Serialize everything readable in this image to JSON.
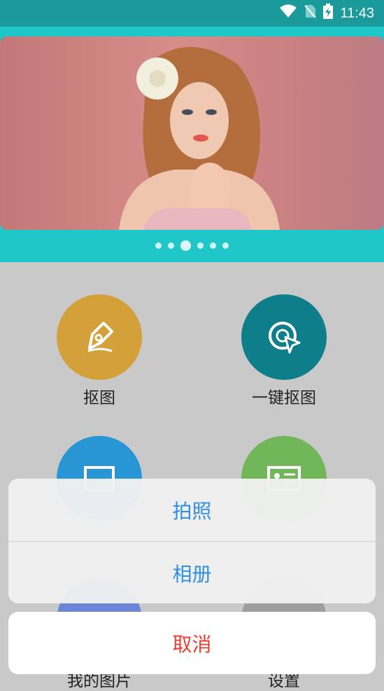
{
  "status": {
    "time": "11:43",
    "icons": [
      "wifi-icon",
      "no-sim-icon",
      "battery-charging-icon"
    ]
  },
  "banner": {
    "active_dot": 2,
    "dot_count": 6
  },
  "grid": {
    "items": [
      {
        "label": "抠图",
        "icon": "pen-icon",
        "color": "#d4a03a"
      },
      {
        "label": "一键抠图",
        "icon": "cursor-target-icon",
        "color": "#0e7f8a"
      },
      {
        "label": "",
        "icon": "image-icon",
        "color": "#2896d4"
      },
      {
        "label": "",
        "icon": "id-card-icon",
        "color": "#72b65a"
      },
      {
        "label": "我的图片",
        "icon": "gallery-icon",
        "color": "#6b86d6"
      },
      {
        "label": "设置",
        "icon": "settings-icon",
        "color": "#9e9e9e"
      }
    ]
  },
  "sheet": {
    "options": [
      "拍照",
      "相册"
    ],
    "cancel": "取消"
  },
  "colors": {
    "statusbar": "#1a9a9a",
    "banner_bg": "#1fc7c9",
    "sheet_option": "#2f8fe0",
    "cancel": "#f03a2e"
  }
}
